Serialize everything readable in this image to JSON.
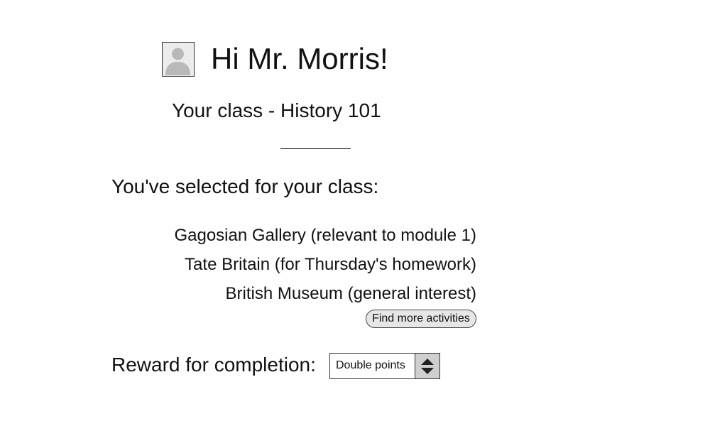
{
  "header": {
    "greeting": "Hi Mr. Morris!",
    "avatar_icon": "user-avatar-placeholder-icon"
  },
  "class_info": {
    "title": "Your class - History 101"
  },
  "selection": {
    "heading": "You've selected for your class:",
    "activities": [
      "Gagosian Gallery (relevant to module 1)",
      "Tate Britain (for Thursday's homework)",
      "British Museum (general interest)"
    ],
    "find_more_label": "Find more activities"
  },
  "reward": {
    "label": "Reward for completion:",
    "selected_value": "Double points",
    "stepper_icon": "up-down-arrows-icon"
  }
}
